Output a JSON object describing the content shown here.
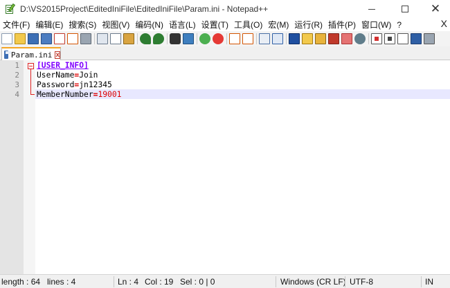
{
  "window": {
    "title": "D:\\VS2015Project\\EditedIniFile\\EditedIniFile\\Param.ini - Notepad++",
    "close_glyph": "✕"
  },
  "menu": {
    "items": [
      "文件(F)",
      "编辑(E)",
      "搜索(S)",
      "视图(V)",
      "编码(N)",
      "语言(L)",
      "设置(T)",
      "工具(O)",
      "宏(M)",
      "运行(R)",
      "插件(P)",
      "窗口(W)",
      "?"
    ],
    "close_label": "X"
  },
  "toolbar": {
    "icons": [
      "new-file-icon",
      "open-file-icon",
      "save-icon",
      "save-all-icon",
      "close-icon",
      "close-all-icon",
      "print-icon",
      "cut-icon",
      "copy-icon",
      "paste-icon",
      "undo-icon",
      "redo-icon",
      "find-icon",
      "replace-icon",
      "zoom-in-icon",
      "zoom-out-icon",
      "sync-vertical-icon",
      "sync-horizontal-icon",
      "word-wrap-icon",
      "show-all-chars-icon",
      "indent-guide-icon",
      "udl-icon",
      "doc-map-icon",
      "function-list-icon",
      "folder-workspace-icon",
      "monitoring-icon",
      "record-macro-icon",
      "stop-macro-icon",
      "play-macro-icon",
      "run-macro-multiple-icon",
      "save-macro-icon"
    ]
  },
  "tab": {
    "label": "Param.ini",
    "close_glyph": "x"
  },
  "editor": {
    "line_numbers": [
      "1",
      "2",
      "3",
      "4"
    ],
    "lines": [
      {
        "key": "[USER_INFO]"
      },
      {
        "key": "UserName",
        "eq": "=",
        "value": "Join"
      },
      {
        "key": "Password",
        "eq": "=",
        "value": "jn12345"
      },
      {
        "key": "MemberNumber",
        "eq": "=",
        "value": "19001"
      }
    ]
  },
  "status": {
    "length": "length : 64",
    "lines": "lines : 4",
    "ln": "Ln : 4",
    "col": "Col : 19",
    "sel": "Sel : 0 | 0",
    "eol": "Windows (CR LF)",
    "encoding": "UTF-8",
    "mode": "IN"
  },
  "colors": {
    "section": "#8000ff",
    "operator": "#dd0000",
    "current_line": "#e8e8ff",
    "tab_accent": "#f5a623"
  }
}
